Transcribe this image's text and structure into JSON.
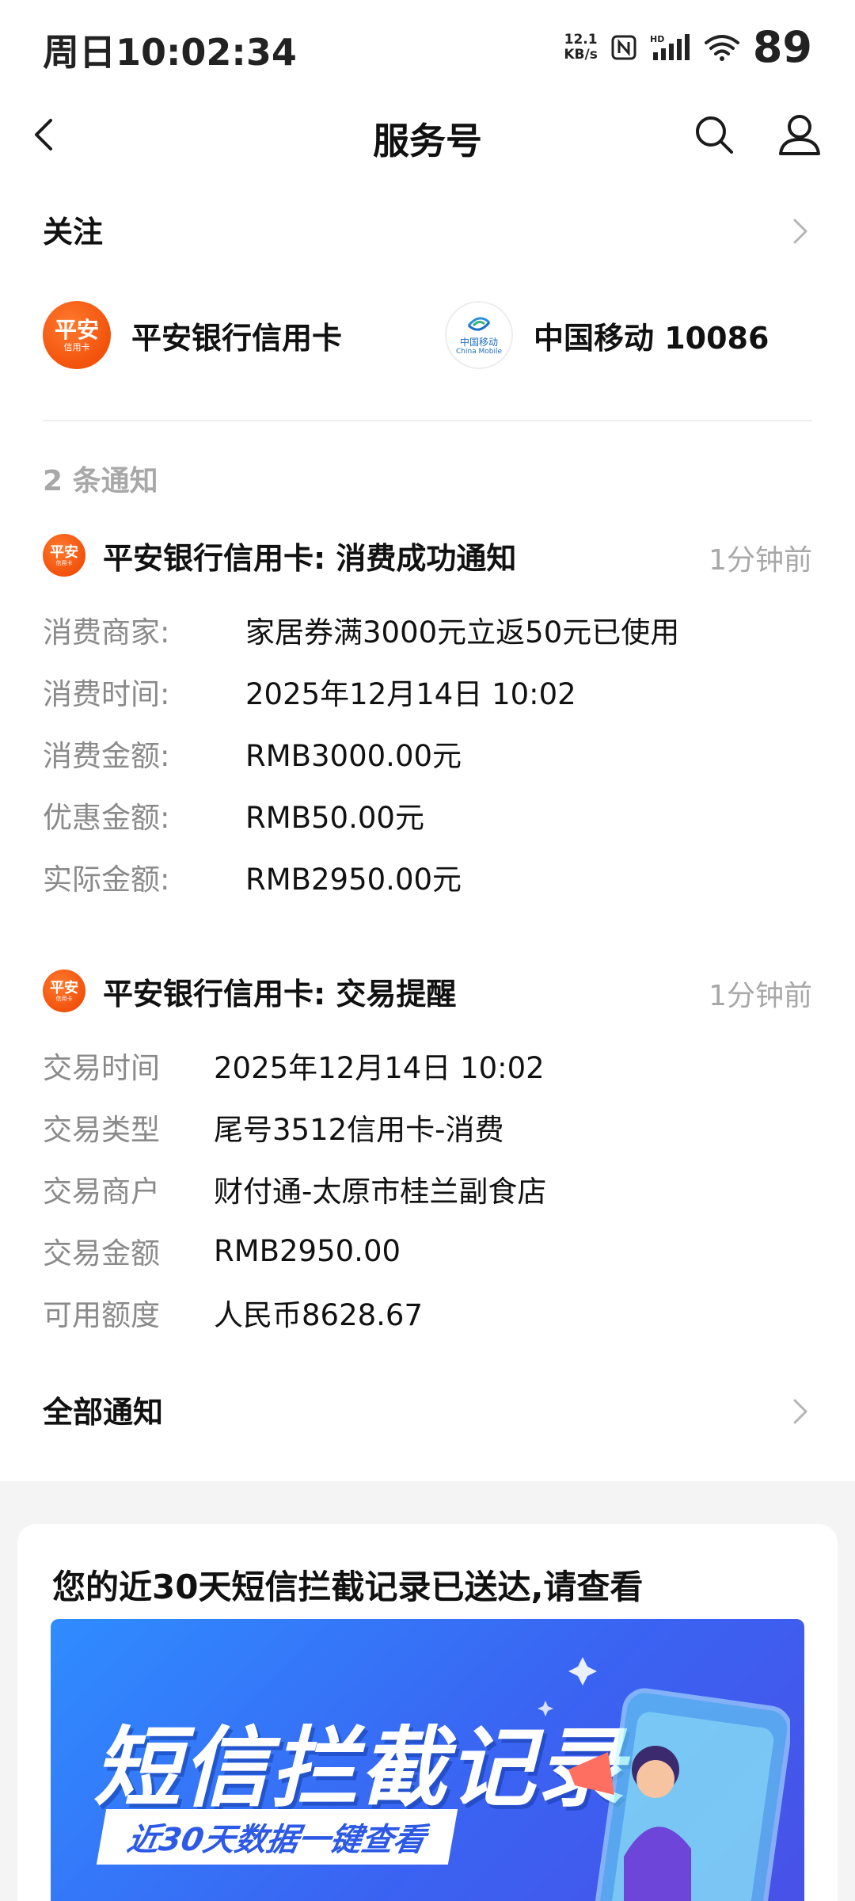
{
  "status": {
    "time": "周日10:02:34",
    "net_speed_value": "12.1",
    "net_speed_unit": "KB/s",
    "battery": "89"
  },
  "header": {
    "title": "服务号"
  },
  "follow": {
    "title": "关注",
    "accounts": [
      {
        "name": "平安银行信用卡",
        "avatar_text": "平安",
        "avatar_sub": "信用卡"
      },
      {
        "name": "中国移动 10086",
        "avatar_text": "中国移动",
        "avatar_sub": "China Mobile"
      }
    ]
  },
  "notices": {
    "count_label": "2 条通知",
    "items": [
      {
        "avatar_text": "平安",
        "avatar_sub": "信用卡",
        "title": "平安银行信用卡: 消费成功通知",
        "time": "1分钟前",
        "rows": [
          {
            "k": "消费商家:",
            "v": "家居券满3000元立返50元已使用"
          },
          {
            "k": "消费时间:",
            "v": "2025年12月14日 10:02"
          },
          {
            "k": "消费金额:",
            "v": "RMB3000.00元"
          },
          {
            "k": "优惠金额:",
            "v": "RMB50.00元"
          },
          {
            "k": "实际金额:",
            "v": "RMB2950.00元"
          }
        ]
      },
      {
        "avatar_text": "平安",
        "avatar_sub": "信用卡",
        "title": "平安银行信用卡: 交易提醒",
        "time": "1分钟前",
        "rows": [
          {
            "k": "交易时间",
            "v": "2025年12月14日 10:02"
          },
          {
            "k": "交易类型",
            "v": "尾号3512信用卡-消费"
          },
          {
            "k": "交易商户",
            "v": "财付通-太原市桂兰副食店"
          },
          {
            "k": "交易金额",
            "v": "RMB2950.00"
          },
          {
            "k": "可用额度",
            "v": "人民币8628.67"
          }
        ]
      }
    ],
    "all_label": "全部通知"
  },
  "card": {
    "title": "您的近30天短信拦截记录已送达,请查看",
    "banner_title": "短信拦截记录",
    "banner_subtitle": "近30天数据一键查看"
  },
  "colors": {
    "brand_orange": "#f2520c",
    "muted_text": "#8a8a8a",
    "banner_blue": "#3a63f2"
  }
}
